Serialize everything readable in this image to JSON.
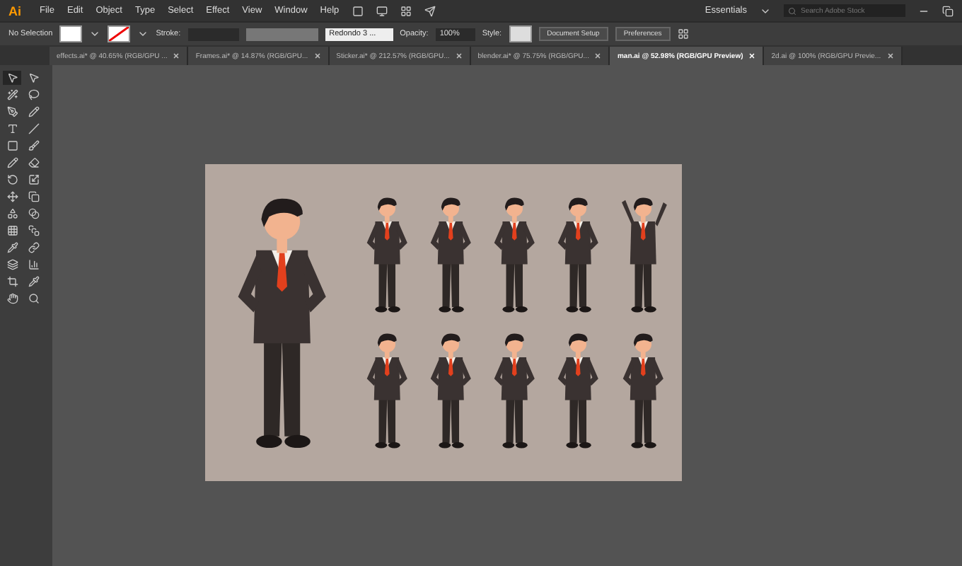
{
  "app_logo": "Ai",
  "menu": [
    "File",
    "Edit",
    "Object",
    "Type",
    "Select",
    "Effect",
    "View",
    "Window",
    "Help"
  ],
  "workspace": {
    "label": "Essentials",
    "search_placeholder": "Search Adobe Stock"
  },
  "control_bar": {
    "selection": "No Selection",
    "stroke_label": "Stroke:",
    "brush": "Redondo 3 ...",
    "opacity_label": "Opacity:",
    "opacity": "100%",
    "style_label": "Style:",
    "buttons": [
      "Document Setup",
      "Preferences"
    ]
  },
  "tabs": [
    {
      "label": "effects.ai* @ 40.65% (RGB/GPU ...",
      "selected": false
    },
    {
      "label": "Frames.ai* @ 14.87% (RGB/GPU...",
      "selected": false
    },
    {
      "label": "Sticker.ai* @ 212.57% (RGB/GPU...",
      "selected": false
    },
    {
      "label": "blender.ai* @ 75.75% (RGB/GPU...",
      "selected": false
    },
    {
      "label": "man.ai @ 52.98% (RGB/GPU Preview)",
      "selected": true
    },
    {
      "label": "2d.ai @ 100% (RGB/GPU Previe...",
      "selected": false
    }
  ]
}
